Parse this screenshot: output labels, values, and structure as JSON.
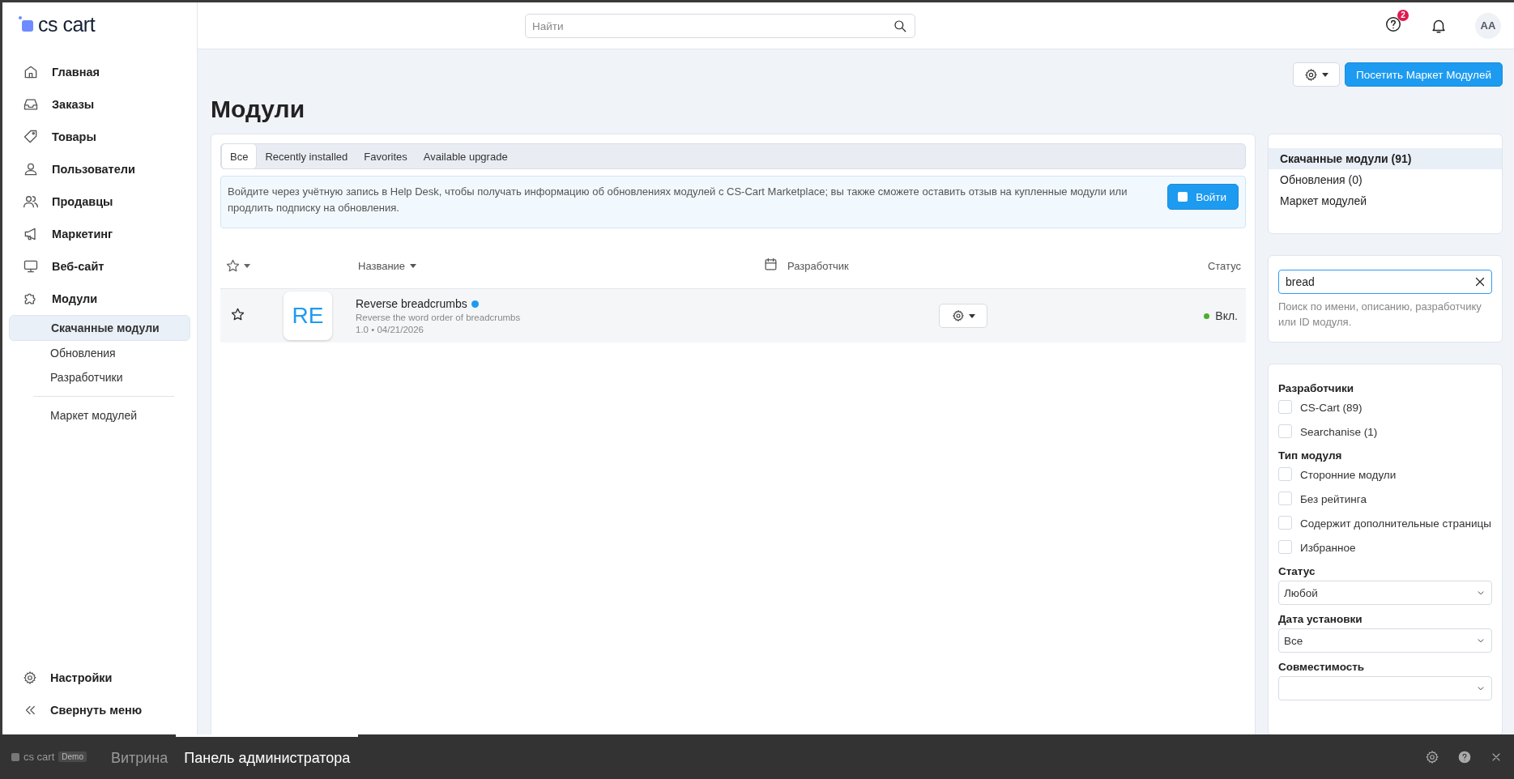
{
  "brand": {
    "logo_text": "cs cart"
  },
  "sidebar": {
    "items": [
      {
        "label": "Главная"
      },
      {
        "label": "Заказы"
      },
      {
        "label": "Товары"
      },
      {
        "label": "Пользователи"
      },
      {
        "label": "Продавцы"
      },
      {
        "label": "Маркетинг"
      },
      {
        "label": "Веб-сайт"
      },
      {
        "label": "Модули",
        "children": [
          {
            "label": "Скачанные модули",
            "selected": true
          },
          {
            "label": "Обновления",
            "selected": false
          },
          {
            "label": "Разработчики",
            "selected": false
          },
          {
            "label": "Маркет модулей",
            "selected": false
          }
        ]
      }
    ],
    "bottom_items": [
      {
        "label": "Настройки"
      },
      {
        "label": "Свернуть меню"
      }
    ]
  },
  "top_bar": {
    "search": {
      "placeholder": "Найти"
    },
    "help_badge": "2",
    "avatar": "AA"
  },
  "toolbar": {
    "visit_button": "Посетить Маркет Модулей"
  },
  "title": "Модули",
  "tabs": [
    {
      "label": "Все",
      "selected": true
    },
    {
      "label": "Recently installed",
      "selected": false
    },
    {
      "label": "Favorites",
      "selected": false
    },
    {
      "label": "Available upgrade",
      "selected": false
    }
  ],
  "notice": {
    "text": "Войдите через учётную запись в Help Desk, чтобы получать информацию об обновлениях модулей с CS-Cart Marketplace; вы также сможете оставить отзыв на купленные модули или продлить подписку на обновления.",
    "button": "Войти"
  },
  "table": {
    "columns": [
      "Название",
      "Разработчик",
      "Статус"
    ],
    "rows": [
      {
        "favorite": false,
        "logo": "RE",
        "name": "Reverse breadcrumbs",
        "verified": true,
        "description": "Reverse the word order of breadcrumbs",
        "meta": "1.0 • 04/21/2026",
        "status": "Вкл.",
        "enabled": true
      }
    ]
  },
  "side_nav": [
    {
      "label": "Скачанные модули (91)",
      "selected": true
    },
    {
      "label": "Обновления (0)",
      "selected": false
    },
    {
      "label": "Маркет модулей",
      "selected": false
    }
  ],
  "module_search": {
    "value": "bread",
    "hint": "Поиск по имени, описанию, разработчику или ID модуля."
  },
  "filter_groups": [
    {
      "title": "Разработчики",
      "options": [
        {
          "label": "CS-Cart (89)",
          "checked": false
        },
        {
          "label": "Searchanise (1)",
          "checked": false
        }
      ]
    },
    {
      "title": "Тип модуля",
      "options": [
        {
          "label": "Сторонние модули",
          "checked": false
        },
        {
          "label": "Без рейтинга",
          "checked": false
        },
        {
          "label": "Содержит дополнительные страницы",
          "checked": false
        },
        {
          "label": "Избранное",
          "checked": false
        }
      ]
    }
  ],
  "filter_selects": [
    {
      "label": "Статус",
      "value": "Любой"
    },
    {
      "label": "Дата установки",
      "value": "Все"
    },
    {
      "label": "Совместимость"
    }
  ],
  "bottom_bar": {
    "logo_text": "cs cart",
    "badge": "Demo",
    "tabs": [
      {
        "label": "Витрина",
        "selected": false
      },
      {
        "label": "Панель администратора",
        "selected": true
      }
    ]
  }
}
